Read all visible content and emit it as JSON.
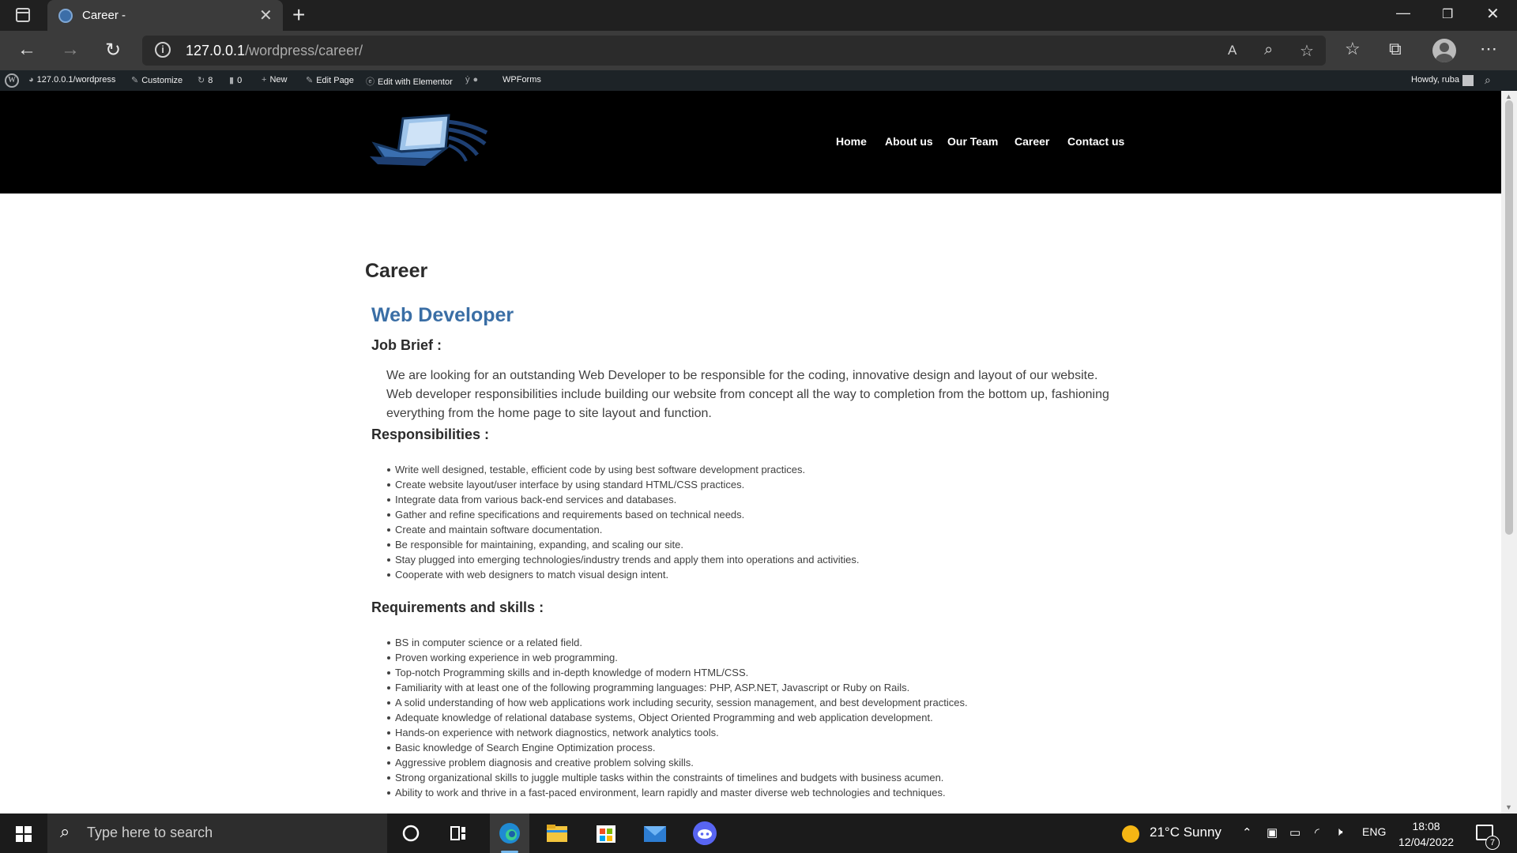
{
  "browser": {
    "tab_title": "Career -",
    "url_host": "127.0.0.1",
    "url_path": "/wordpress/career/"
  },
  "adminbar": {
    "site": "127.0.0.1/wordpress",
    "customize": "Customize",
    "updates": "8",
    "comments": "0",
    "new": "New",
    "edit_page": "Edit Page",
    "edit_elementor": "Edit with Elementor",
    "wpforms": "WPForms",
    "howdy": "Howdy, ruba"
  },
  "menu": [
    "Home",
    "About us",
    "Our Team",
    "Career",
    "Contact us"
  ],
  "page": {
    "title": "Career",
    "job_title": "Web Developer",
    "brief_heading": "Job Brief :",
    "brief_text": "We are looking for an outstanding Web Developer to be responsible for the coding, innovative design and layout of our website. Web developer responsibilities include building our website from concept all the way to completion from the bottom up, fashioning everything from the home page to site layout and function.",
    "resp_heading": "Responsibilities :",
    "responsibilities": [
      "Write well designed, testable, efficient code by using best software development practices.",
      "Create website layout/user interface by using standard HTML/CSS practices.",
      "Integrate data from various back-end services and databases.",
      "Gather and refine specifications and requirements based on technical needs.",
      "Create and maintain software documentation.",
      "Be responsible for maintaining, expanding, and scaling our site.",
      "Stay plugged into emerging technologies/industry trends and apply them into operations and activities.",
      "Cooperate with web designers to match visual design intent."
    ],
    "req_heading": "Requirements and skills :",
    "requirements": [
      "BS in computer science or a related field.",
      "Proven working experience in web programming.",
      "Top-notch Programming skills and in-depth knowledge of modern HTML/CSS.",
      "Familiarity with at least one of the following programming languages: PHP, ASP.NET, Javascript or Ruby on Rails.",
      "A solid understanding of how web applications work including security, session management, and best development practices.",
      "Adequate knowledge of relational database systems, Object Oriented Programming and web application development.",
      "Hands-on experience with network diagnostics, network analytics tools.",
      "Basic knowledge of Search Engine Optimization process.",
      "Aggressive problem diagnosis and creative problem solving skills.",
      "Strong organizational skills to juggle multiple tasks within the constraints of  timelines and budgets with business acumen.",
      "Ability to work and thrive in a fast-paced environment, learn rapidly and master diverse web technologies and techniques."
    ]
  },
  "taskbar": {
    "search_placeholder": "Type here to search",
    "weather": "21°C  Sunny",
    "lang": "ENG",
    "time": "18:08",
    "date": "12/04/2022",
    "notifications": "7"
  },
  "colors": {
    "accent_link": "#3a6ea5",
    "header_bg": "#000000",
    "adminbar_bg": "#1d2327"
  }
}
